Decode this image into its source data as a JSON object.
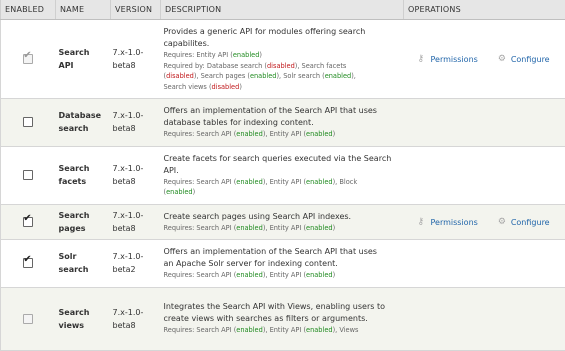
{
  "headers": [
    "ENABLED",
    "NAME",
    "VERSION",
    "DESCRIPTION",
    "OPERATIONS"
  ],
  "colors": {
    "enabled": "#1f8a1f",
    "disabled": "#c0181b",
    "link": "#2266aa",
    "stripe": "#f3f4ee"
  },
  "rows": [
    {
      "checked": true,
      "locked": true,
      "name": [
        "Search",
        "API"
      ],
      "version": [
        "7.x-1.0-",
        "beta8"
      ],
      "desc": [
        "Provides a generic API for modules offering search",
        "capabilites."
      ],
      "req": [
        [
          [
            "Requires: Entity API (",
            ""
          ],
          [
            "enabled",
            "ok"
          ],
          [
            ")",
            ""
          ]
        ],
        [
          [
            "Required by: Database search (",
            ""
          ],
          [
            "disabled",
            "no"
          ],
          [
            "), Search facets",
            ""
          ]
        ],
        [
          [
            "(",
            ""
          ],
          [
            "disabled",
            "no"
          ],
          [
            "), Search pages (",
            ""
          ],
          [
            "enabled",
            "ok"
          ],
          [
            "), Solr search (",
            ""
          ],
          [
            "enabled",
            "ok"
          ],
          [
            "),",
            ""
          ]
        ],
        [
          [
            "Search views (",
            ""
          ],
          [
            "disabled",
            "no"
          ],
          [
            ")",
            ""
          ]
        ]
      ],
      "ops": [
        {
          "label": "Permissions",
          "icon": "key-icon"
        },
        {
          "label": "Configure",
          "icon": "gear-icon"
        }
      ]
    },
    {
      "checked": false,
      "locked": false,
      "name": [
        "Database",
        "search"
      ],
      "version": [
        "7.x-1.0-",
        "beta8"
      ],
      "desc": [
        "Offers an implementation of the Search API that uses",
        "database tables for indexing content."
      ],
      "req": [
        [
          [
            "Requires: Search API (",
            ""
          ],
          [
            "enabled",
            "ok"
          ],
          [
            "), Entity API (",
            ""
          ],
          [
            "enabled",
            "ok"
          ],
          [
            ")",
            ""
          ]
        ]
      ],
      "ops": []
    },
    {
      "checked": false,
      "locked": false,
      "name": [
        "Search",
        "facets"
      ],
      "version": [
        "7.x-1.0-",
        "beta8"
      ],
      "desc": [
        "Create facets for search queries executed via the Search",
        "API."
      ],
      "req": [
        [
          [
            "Requires: Search API (",
            ""
          ],
          [
            "enabled",
            "ok"
          ],
          [
            "), Entity API (",
            ""
          ],
          [
            "enabled",
            "ok"
          ],
          [
            "), Block",
            ""
          ]
        ],
        [
          [
            "(",
            ""
          ],
          [
            "enabled",
            "ok"
          ],
          [
            ")",
            ""
          ]
        ]
      ],
      "ops": []
    },
    {
      "checked": true,
      "locked": false,
      "name": [
        "Search",
        "pages"
      ],
      "version": [
        "7.x-1.0-",
        "beta8"
      ],
      "desc": [
        "Create search pages using Search API indexes."
      ],
      "req": [
        [
          [
            "Requires: Search API (",
            ""
          ],
          [
            "enabled",
            "ok"
          ],
          [
            "), Entity API (",
            ""
          ],
          [
            "enabled",
            "ok"
          ],
          [
            ")",
            ""
          ]
        ]
      ],
      "ops": [
        {
          "label": "Permissions",
          "icon": "key-icon"
        },
        {
          "label": "Configure",
          "icon": "gear-icon"
        }
      ]
    },
    {
      "checked": true,
      "locked": false,
      "name": [
        "Solr",
        "search"
      ],
      "version": [
        "7.x-1.0-",
        "beta2"
      ],
      "desc": [
        "Offers an implementation of the Search API that uses",
        "an Apache Solr server for indexing content."
      ],
      "req": [
        [
          [
            "Requires: Search API (",
            ""
          ],
          [
            "enabled",
            "ok"
          ],
          [
            "), Entity API (",
            ""
          ],
          [
            "enabled",
            "ok"
          ],
          [
            ")",
            ""
          ]
        ]
      ],
      "ops": []
    },
    {
      "checked": false,
      "locked": true,
      "name": [
        "Search",
        "views"
      ],
      "version": [
        "7.x-1.0-",
        "beta8"
      ],
      "desc": [
        "Integrates the Search API with Views, enabling users to",
        "create views with searches as filters or arguments."
      ],
      "req": [
        [
          [
            "Requires: Search API (",
            ""
          ],
          [
            "enabled",
            "ok"
          ],
          [
            "), Entity API (",
            ""
          ],
          [
            "enabled",
            "ok"
          ],
          [
            "), Views",
            ""
          ]
        ]
      ],
      "ops": []
    }
  ]
}
